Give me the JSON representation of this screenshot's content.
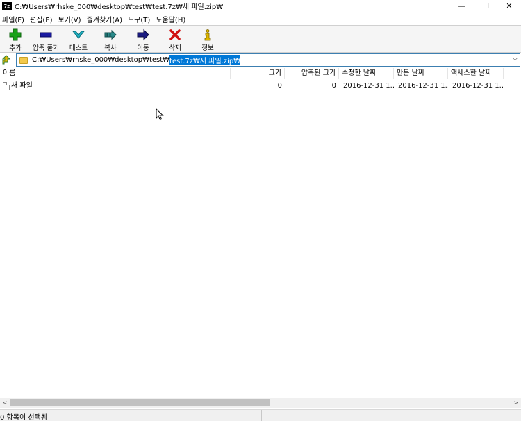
{
  "window": {
    "app_icon": "7z",
    "title": "C:₩Users₩rhske_000₩desktop₩test₩test.7z₩새 파일.zip₩",
    "controls": {
      "minimize": "—",
      "maximize": "☐",
      "close": "✕"
    }
  },
  "menu": [
    {
      "label": "파일(F)"
    },
    {
      "label": "편집(E)"
    },
    {
      "label": "보기(V)"
    },
    {
      "label": "즐겨찾기(A)"
    },
    {
      "label": "도구(T)"
    },
    {
      "label": "도움말(H)"
    }
  ],
  "toolbar": [
    {
      "label": "추가",
      "icon": "add-icon",
      "color": "#1aa11a"
    },
    {
      "label": "압축 풀기",
      "icon": "extract-icon",
      "color": "#1a1aa0"
    },
    {
      "label": "테스트",
      "icon": "test-icon",
      "color": "#1fb0c0"
    },
    {
      "label": "복사",
      "icon": "copy-icon",
      "color": "#2a8a8a"
    },
    {
      "label": "이동",
      "icon": "move-icon",
      "color": "#1a1a80"
    },
    {
      "label": "삭제",
      "icon": "delete-icon",
      "color": "#d01010"
    },
    {
      "label": "정보",
      "icon": "info-icon",
      "color": "#e0b800"
    }
  ],
  "address": {
    "prefix": "C:₩Users₩rhske_000₩desktop₩test₩",
    "selected": "test.7z₩새 파일.zip₩",
    "dropdown": "⌵"
  },
  "columns": [
    "이름",
    "크기",
    "압축된 크기",
    "수정한 날짜",
    "만든 날짜",
    "액세스한 날짜"
  ],
  "rows": [
    {
      "name": "새 파일",
      "size": "0",
      "packed": "0",
      "modified": "2016-12-31 1...",
      "created": "2016-12-31 1...",
      "accessed": "2016-12-31 1..."
    }
  ],
  "scrollbar": {
    "left": "<",
    "right": ">"
  },
  "status": {
    "text": "0 항목이 선택됨"
  }
}
